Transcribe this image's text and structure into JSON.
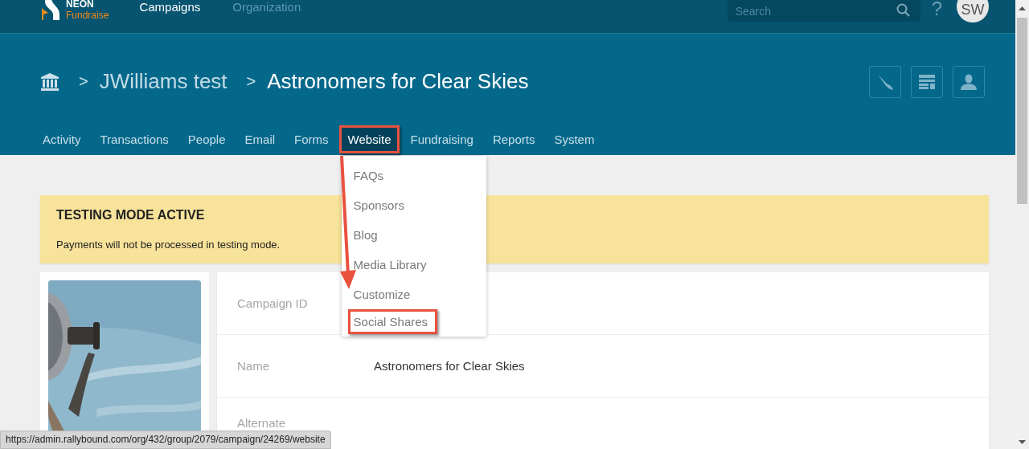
{
  "top_nav": {
    "logo": {
      "line1": "NEON",
      "line2": "Fundraise"
    },
    "links": [
      {
        "label": "Campaigns",
        "selected": true
      },
      {
        "label": "Organization",
        "selected": false
      }
    ],
    "search": {
      "placeholder": "Search"
    },
    "help": "?",
    "avatar": "SW"
  },
  "breadcrumb": [
    {
      "separator": ">",
      "label": "JWilliams test"
    },
    {
      "separator": ">",
      "label": "Astronomers for Clear Skies"
    }
  ],
  "tabs": [
    {
      "label": "Activity",
      "selected": false,
      "annotated": false
    },
    {
      "label": "Transactions",
      "selected": false,
      "annotated": false
    },
    {
      "label": "People",
      "selected": false,
      "annotated": false
    },
    {
      "label": "Email",
      "selected": false,
      "annotated": false
    },
    {
      "label": "Forms",
      "selected": false,
      "annotated": false
    },
    {
      "label": "Website",
      "selected": true,
      "annotated": true,
      "annotation_arrow": true,
      "menu": [
        {
          "label": "FAQs",
          "annotated": false
        },
        {
          "label": "Sponsors",
          "annotated": false
        },
        {
          "label": "Blog",
          "annotated": false
        },
        {
          "label": "Media Library",
          "annotated": false
        },
        {
          "label": "Customize",
          "annotated": false
        },
        {
          "label": "Social Shares",
          "annotated": true
        }
      ]
    },
    {
      "label": "Fundraising",
      "selected": false,
      "annotated": false
    },
    {
      "label": "Reports",
      "selected": false,
      "annotated": false
    },
    {
      "label": "System",
      "selected": false,
      "annotated": false
    }
  ],
  "alert": {
    "title": "TESTING MODE ACTIVE",
    "message": "Payments will not be processed in testing mode."
  },
  "details": [
    {
      "label": "Campaign ID"
    },
    {
      "label": "Name",
      "value": "Astronomers for Clear Skies"
    },
    {
      "label": "Alternate"
    }
  ],
  "status_url": "https://admin.rallybound.com/org/432/group/2079/campaign/24269/website"
}
